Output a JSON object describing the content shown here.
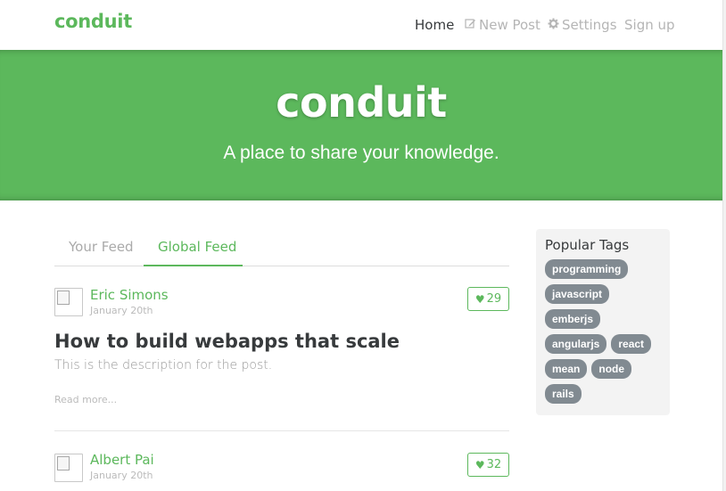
{
  "navbar": {
    "brand": "conduit",
    "links": {
      "home": "Home",
      "new_post": "New Post",
      "settings": "Settings",
      "sign_up": "Sign up"
    }
  },
  "banner": {
    "title": "conduit",
    "subtitle": "A place to share your knowledge."
  },
  "feed": {
    "tabs": {
      "your": "Your Feed",
      "global": "Global Feed"
    },
    "articles": [
      {
        "author": "Eric Simons",
        "date": "January 20th",
        "likes": "29",
        "title": "How to build webapps that scale",
        "description": "This is the description for the post.",
        "read_more": "Read more..."
      },
      {
        "author": "Albert Pai",
        "date": "January 20th",
        "likes": "32"
      }
    ]
  },
  "sidebar": {
    "title": "Popular Tags",
    "tags": [
      "programming",
      "javascript",
      "emberjs",
      "angularjs",
      "react",
      "mean",
      "node",
      "rails"
    ]
  },
  "colors": {
    "accent": "#5cb85c",
    "tag_bg": "#818a91"
  }
}
